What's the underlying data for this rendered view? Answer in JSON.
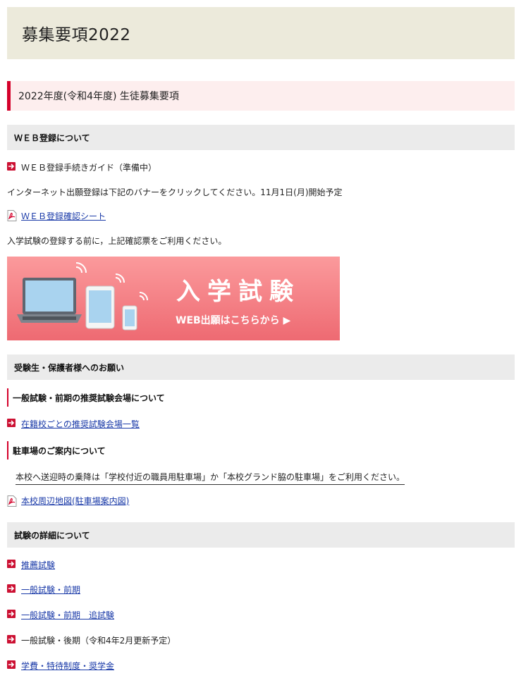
{
  "page": {
    "title": "募集要項2022",
    "subtitle": "2022年度(令和4年度) 生徒募集要項"
  },
  "web_section": {
    "heading": "ＷＥＢ登録について",
    "guide": "ＷＥＢ登録手続きガイド（準備中）",
    "info": "インターネット出願登録は下記のバナーをクリックしてください。11月1日(月)開始予定",
    "check_sheet_link": "ＷＥＢ登録確認シート",
    "note": "入学試験の登録する前に，上記確認票をご利用ください。",
    "banner": {
      "main_text": "入学試験",
      "sub_text": "WEB出願はこちらから ▶"
    }
  },
  "request_section": {
    "heading": "受験生・保護者様へのお願い",
    "venue_heading": "一般試験・前期の推奨試験会場について",
    "venue_link": "在籍校ごとの推奨試験会場一覧",
    "parking_heading": "駐車場のご案内について",
    "parking_note": "本校へ送迎時の乗降は「学校付近の職員用駐車場」か「本校グランド脇の駐車場」をご利用ください。",
    "map_link": "本校周辺地図(駐車場案内図)"
  },
  "detail_section": {
    "heading": "試験の詳細について",
    "items": [
      {
        "label": "推薦試験",
        "is_link": true
      },
      {
        "label": "一般試験・前期",
        "is_link": true
      },
      {
        "label": "一般試験・前期　追試験",
        "is_link": true
      },
      {
        "label": "一般試験・後期（令和4年2月更新予定）",
        "is_link": false
      },
      {
        "label": "学費・特待制度・奨学金",
        "is_link": true
      }
    ]
  },
  "colors": {
    "accent_red": "#d4002a",
    "link_blue": "#1a3aa8",
    "title_bg": "#eceadb",
    "subtitle_bg": "#fdeeee",
    "section_bg": "#ebebeb",
    "banner_top": "#fb9a9c",
    "banner_bottom": "#ee6a72"
  }
}
